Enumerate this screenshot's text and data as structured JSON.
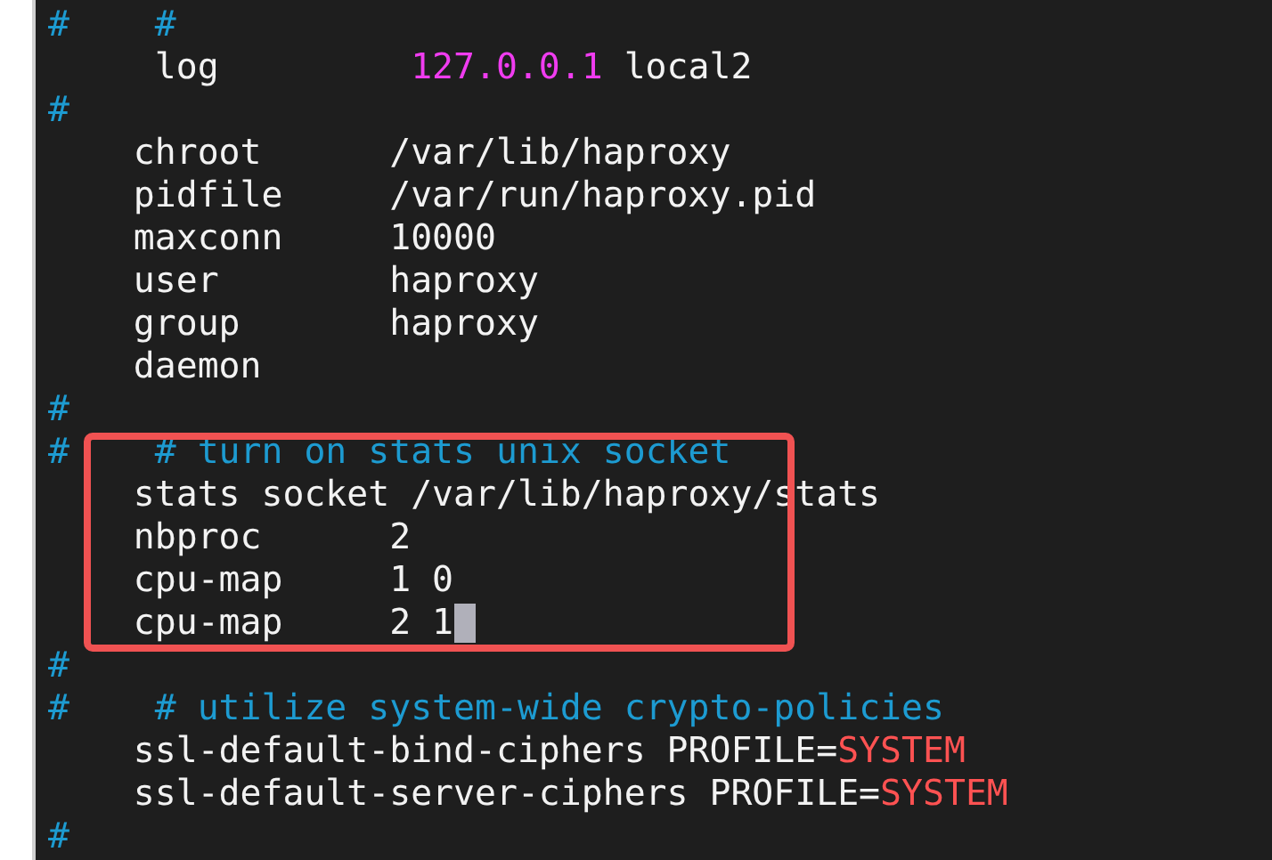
{
  "editor": {
    "blocks": [
      {
        "highlighted": false,
        "lines": [
          {
            "segments": [
              {
                "kind": "comment",
                "text": "#    #"
              }
            ]
          },
          {
            "segments": [
              {
                "kind": "plain",
                "text": "     log         "
              },
              {
                "kind": "number",
                "text": "127.0.0.1"
              },
              {
                "kind": "plain",
                "text": " local2"
              }
            ]
          },
          {
            "segments": [
              {
                "kind": "comment",
                "text": "#"
              }
            ]
          },
          {
            "segments": [
              {
                "kind": "plain",
                "text": "    chroot      /var/lib/haproxy"
              }
            ]
          },
          {
            "segments": [
              {
                "kind": "plain",
                "text": "    pidfile     /var/run/haproxy.pid"
              }
            ]
          },
          {
            "segments": [
              {
                "kind": "plain",
                "text": "    maxconn     10000"
              }
            ]
          },
          {
            "segments": [
              {
                "kind": "plain",
                "text": "    user        haproxy"
              }
            ]
          },
          {
            "segments": [
              {
                "kind": "plain",
                "text": "    group       haproxy"
              }
            ]
          },
          {
            "segments": [
              {
                "kind": "plain",
                "text": "    daemon"
              }
            ]
          },
          {
            "segments": [
              {
                "kind": "comment",
                "text": "#"
              }
            ]
          }
        ]
      },
      {
        "highlighted": true,
        "lines": [
          {
            "segments": [
              {
                "kind": "comment",
                "text": "#"
              },
              {
                "kind": "comment",
                "text": "    # turn on stats unix socket"
              }
            ]
          },
          {
            "segments": [
              {
                "kind": "plain",
                "text": "    stats socket /var/lib/haproxy/stats"
              }
            ]
          },
          {
            "segments": [
              {
                "kind": "plain",
                "text": "    nbproc      2"
              }
            ]
          },
          {
            "segments": [
              {
                "kind": "plain",
                "text": "    cpu-map     1 0"
              }
            ]
          },
          {
            "segments": [
              {
                "kind": "plain",
                "text": "    cpu-map     2 1"
              }
            ],
            "cursor": true
          }
        ]
      },
      {
        "highlighted": false,
        "lines": [
          {
            "segments": [
              {
                "kind": "comment",
                "text": "#"
              }
            ]
          },
          {
            "segments": [
              {
                "kind": "comment",
                "text": "#"
              },
              {
                "kind": "comment",
                "text": "    # utilize system-wide crypto-policies"
              }
            ]
          },
          {
            "segments": [
              {
                "kind": "plain",
                "text": "    ssl-default-bind-ciphers PROFILE="
              },
              {
                "kind": "constant",
                "text": "SYSTEM"
              }
            ]
          },
          {
            "segments": [
              {
                "kind": "plain",
                "text": "    ssl-default-server-ciphers PROFILE="
              },
              {
                "kind": "constant",
                "text": "SYSTEM"
              }
            ]
          },
          {
            "segments": [
              {
                "kind": "comment",
                "text": "#"
              }
            ]
          }
        ]
      }
    ]
  }
}
